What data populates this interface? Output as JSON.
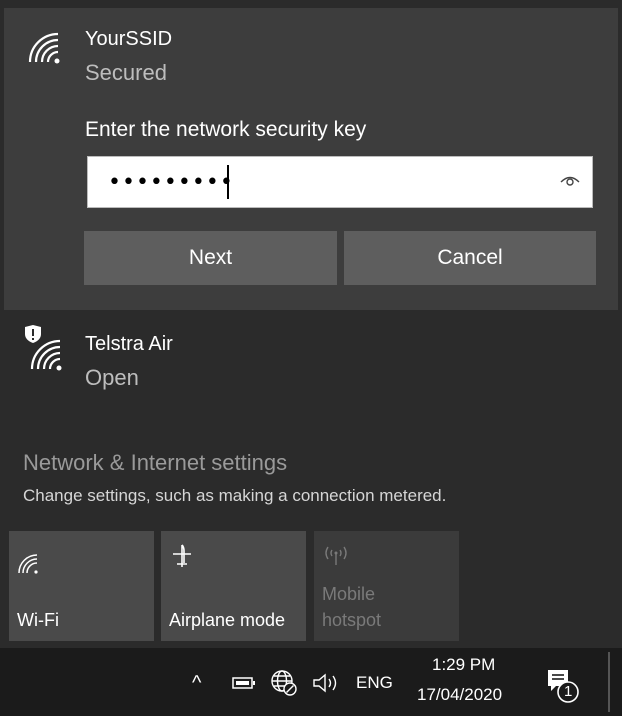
{
  "networks": [
    {
      "name": "YourSSID",
      "status": "Secured",
      "icon": "wifi-signal-icon"
    },
    {
      "name": "Telstra Air",
      "status": "Open",
      "icon": "wifi-shield-warning-icon"
    }
  ],
  "key_prompt": {
    "label": "Enter the network security key",
    "masked_value": "•••••••••",
    "reveal_icon": "eye-icon"
  },
  "buttons": {
    "next": "Next",
    "cancel": "Cancel"
  },
  "settings": {
    "title": "Network & Internet settings",
    "subtitle": "Change settings, such as making a connection metered."
  },
  "quick_actions": [
    {
      "label": "Wi-Fi",
      "icon": "wifi-icon",
      "enabled": true
    },
    {
      "label": "Airplane mode",
      "icon": "airplane-icon",
      "enabled": true
    },
    {
      "label_line1": "Mobile",
      "label_line2": "hotspot",
      "icon": "hotspot-icon",
      "enabled": false
    }
  ],
  "taskbar": {
    "chevron": "^",
    "language": "ENG",
    "time": "1:29 PM",
    "date": "17/04/2020",
    "notification_count": "1"
  },
  "colors": {
    "panel_bg": "#2b2b2b",
    "selected_bg": "#3d3d3d",
    "button_bg": "#5e5e5e",
    "taskbar_bg": "#1b1b1b"
  }
}
